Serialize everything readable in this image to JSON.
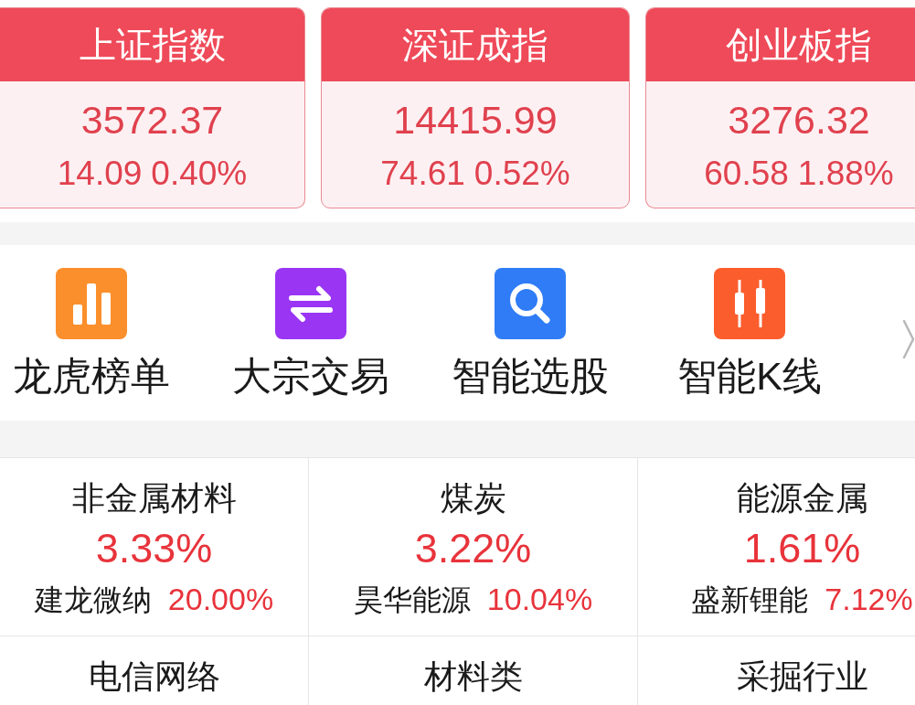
{
  "indices": [
    {
      "name": "上证指数",
      "value": "3572.37",
      "change": "14.09",
      "change_pct": "0.40%"
    },
    {
      "name": "深证成指",
      "value": "14415.99",
      "change": "74.61",
      "change_pct": "0.52%"
    },
    {
      "name": "创业板指",
      "value": "3276.32",
      "change": "60.58",
      "change_pct": "1.88%"
    }
  ],
  "shortcuts": [
    {
      "label": "龙虎榜单",
      "kind": "bar-chart",
      "color": "#fb8f2c"
    },
    {
      "label": "大宗交易",
      "kind": "swap",
      "color": "#9a35f4"
    },
    {
      "label": "智能选股",
      "kind": "search",
      "color": "#2f7cf6"
    },
    {
      "label": "智能K线",
      "kind": "candles",
      "color": "#fc5d2c"
    }
  ],
  "sectors": [
    {
      "name": "非金属材料",
      "change_pct": "3.33%",
      "top_stock": "建龙微纳",
      "top_stock_pct": "20.00%"
    },
    {
      "name": "煤炭",
      "change_pct": "3.22%",
      "top_stock": "昊华能源",
      "top_stock_pct": "10.04%"
    },
    {
      "name": "能源金属",
      "change_pct": "1.61%",
      "top_stock": "盛新锂能",
      "top_stock_pct": "7.12%"
    },
    {
      "name": "电信网络"
    },
    {
      "name": "材料类"
    },
    {
      "name": "采掘行业"
    }
  ]
}
